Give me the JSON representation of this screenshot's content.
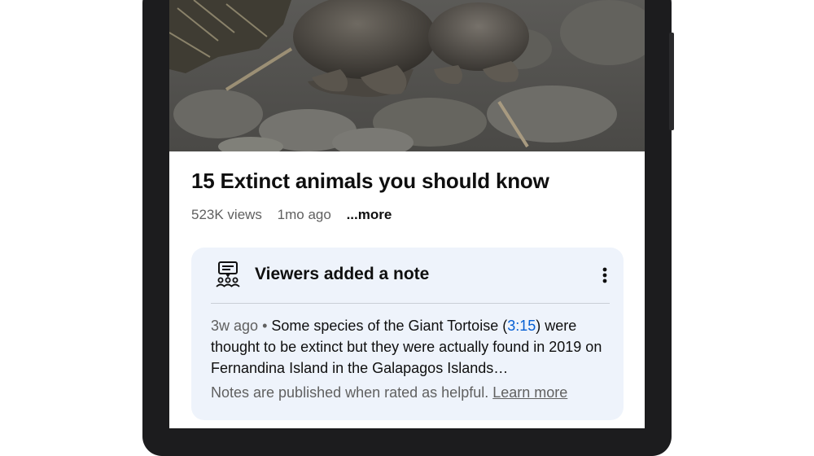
{
  "video": {
    "title": "15 Extinct animals you should know",
    "views": "523K views",
    "age": "1mo ago",
    "more_label": "...more"
  },
  "note": {
    "icon": "community-notes-icon",
    "heading": "Viewers added a note",
    "menu_icon": "kebab-menu-icon",
    "time": "3w ago",
    "separator": "•",
    "text_before": "Some species of the Giant Tortoise (",
    "timestamp": "3:15",
    "text_after": ") were thought to be extinct but they were actually found in 2019 on Fernandina Island in the Galapagos Islands…",
    "footer_text": "Notes are published when rated as helpful.",
    "learn_more": "Learn more"
  },
  "colors": {
    "note_background": "#eef3fb",
    "link_blue": "#065fd4"
  }
}
